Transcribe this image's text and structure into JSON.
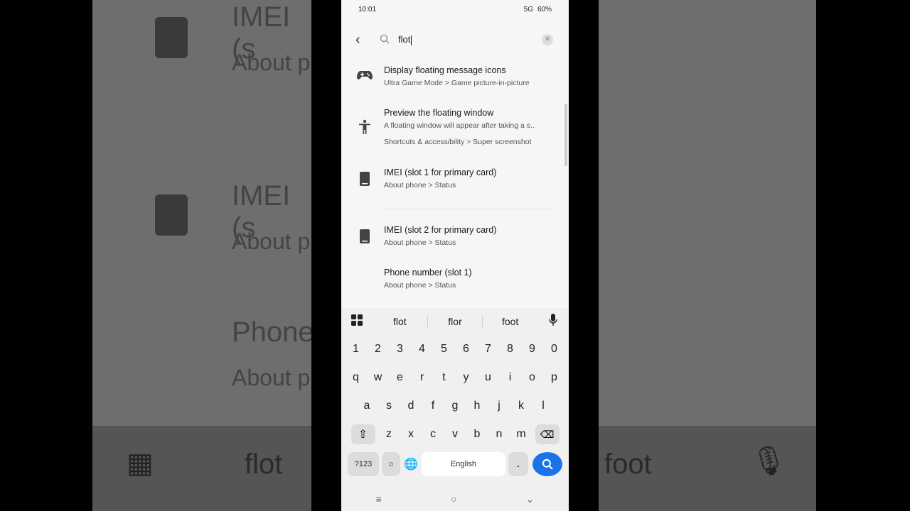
{
  "status": {
    "time": "10:01",
    "battery": "60%",
    "signal": "5G"
  },
  "search": {
    "query": "flot"
  },
  "results": [
    {
      "icon": "gamepad-icon",
      "title": "Display floating message icons",
      "subtitle": "Ultra Game Mode > Game picture-in-picture"
    },
    {
      "icon": "accessibility-icon",
      "title": "Preview the floating window",
      "subtitle": "A floating window will appear after taking a s..",
      "subtitle2": "Shortcuts & accessibility > Super screenshot"
    },
    {
      "icon": "phone-icon",
      "title": "IMEI (slot 1 for primary card)",
      "subtitle": "About phone > Status"
    },
    {
      "icon": "phone-icon",
      "title": "IMEI (slot 2 for primary card)",
      "subtitle": "About phone > Status"
    },
    {
      "icon": "",
      "title": "Phone number (slot 1)",
      "subtitle": "About phone > Status"
    }
  ],
  "keyboard": {
    "suggestions": [
      "flot",
      "flor",
      "foot"
    ],
    "row_numbers": [
      "1",
      "2",
      "3",
      "4",
      "5",
      "6",
      "7",
      "8",
      "9",
      "0"
    ],
    "row1": [
      "q",
      "w",
      "e",
      "r",
      "t",
      "y",
      "u",
      "i",
      "o",
      "p"
    ],
    "row2": [
      "a",
      "s",
      "d",
      "f",
      "g",
      "h",
      "j",
      "k",
      "l"
    ],
    "row3": [
      "z",
      "x",
      "c",
      "v",
      "b",
      "n",
      "m"
    ],
    "symbols_label": "?123",
    "space_label": "English",
    "period_label": "."
  },
  "background": {
    "left_texts": [
      "IMEI (s",
      "About p",
      "IMEI (s",
      "About p",
      "Phone",
      "About p"
    ],
    "bottom_left": "flot",
    "bottom_right": "foot"
  }
}
